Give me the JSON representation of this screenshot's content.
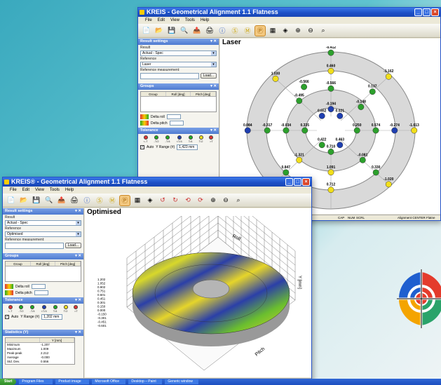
{
  "back_window": {
    "title": "KREIS - Geometrical Alignment 1.1  Flatness",
    "menu": [
      "File",
      "Edit",
      "View",
      "Tools",
      "Help"
    ],
    "panels": {
      "result_settings": {
        "header": "Result settings",
        "result_label": "Result",
        "result_value": "Actual - Spec",
        "reference_label": "Reference",
        "reference_value": "Laser",
        "ref_measurement_label": "Reference measurement:",
        "load_button": "Load..."
      },
      "groups": {
        "header": "Groups",
        "columns": [
          "Group",
          "Roll [deg]",
          "Pitch [deg]"
        ],
        "delta_roll_label": "Delta roll",
        "delta_pitch_label": "Delta pitch"
      },
      "tolerance": {
        "header": "Tolerance",
        "labels": [
          "<-T",
          "-T/2",
          "-T/4",
          "<T/4",
          "T/4",
          "T/2",
          ">T"
        ],
        "auto_label": "Auto",
        "yrange_label": "Y Range (#)",
        "yrange_value": "1,423 mm"
      }
    },
    "main_title": "Laser",
    "status": [
      "CAP",
      "NUM",
      "SCRL"
    ],
    "status_right": "Alignment CENTER Flatne",
    "values": [
      {
        "t": "-0.412",
        "c": "green"
      },
      {
        "t": "0.460",
        "c": "yellow"
      },
      {
        "t": "-1.162",
        "c": "yellow"
      },
      {
        "t": "1.030",
        "c": "yellow"
      },
      {
        "t": "-0.566",
        "c": "green"
      },
      {
        "t": "-0.566",
        "c": "green"
      },
      {
        "t": "0.137",
        "c": "green"
      },
      {
        "t": "-0.495",
        "c": "green"
      },
      {
        "t": "-0.148",
        "c": "green"
      },
      {
        "t": "-0.194",
        "c": "blue"
      },
      {
        "t": "0.652",
        "c": "blue"
      },
      {
        "t": "0.021",
        "c": "blue"
      },
      {
        "t": "0.084",
        "c": "blue"
      },
      {
        "t": "-0.317",
        "c": "green"
      },
      {
        "t": "-0.034",
        "c": "green"
      },
      {
        "t": "0.335",
        "c": "green"
      },
      {
        "t": "0.250",
        "c": "green"
      },
      {
        "t": "0.574",
        "c": "green"
      },
      {
        "t": "-0.274",
        "c": "blue"
      },
      {
        "t": "-1.613",
        "c": "yellow"
      },
      {
        "t": "0.422",
        "c": "green"
      },
      {
        "t": "0.463",
        "c": "blue"
      },
      {
        "t": "0.710",
        "c": "green"
      },
      {
        "t": "-1.321",
        "c": "yellow"
      },
      {
        "t": "-0.081",
        "c": "green"
      },
      {
        "t": "0.847",
        "c": "green"
      },
      {
        "t": "1.091",
        "c": "yellow"
      },
      {
        "t": "0.330",
        "c": "green"
      },
      {
        "t": "-0.903",
        "c": "blue"
      },
      {
        "t": "0.712",
        "c": "yellow"
      },
      {
        "t": "-1.020",
        "c": "yellow"
      }
    ]
  },
  "front_window": {
    "title": "KREIS® - Geometrical Alignment 1.1  Flatness",
    "menu": [
      "File",
      "Edit",
      "View",
      "Tools",
      "Help"
    ],
    "panels": {
      "result_settings": {
        "header": "Result settings",
        "result_label": "Result",
        "result_value": "Actual - Spec",
        "reference_label": "Reference",
        "reference_value": "Optimised",
        "ref_measurement_label": "Reference measurement:",
        "load_button": "Load..."
      },
      "groups": {
        "header": "Groups",
        "columns": [
          "Group",
          "Roll [deg]",
          "Pitch [deg]"
        ],
        "delta_roll_label": "Delta roll",
        "delta_pitch_label": "Delta pitch"
      },
      "tolerance": {
        "header": "Tolerance",
        "labels": [
          "<-T",
          "-T/2",
          "-T/4",
          "<T/4",
          "T/4",
          "T/2",
          ">T"
        ],
        "auto_label": "Auto",
        "yrange_label": "Y Range (#)",
        "yrange_value": "1,202 mm"
      },
      "statistics": {
        "header": "Statistics (Y)",
        "col": "Y [mm]",
        "rows": [
          {
            "k": "Minimum",
            "v": "-1.207"
          },
          {
            "k": "Maximum",
            "v": "1.009"
          },
          {
            "k": "Peak-peak",
            "v": "2.212"
          },
          {
            "k": "Average",
            "v": "-0.000"
          },
          {
            "k": "Std. Dev.",
            "v": "0.556"
          }
        ]
      }
    },
    "main_title": "Optimised",
    "axis_roll": "Roll",
    "axis_pitch": "Pitch",
    "axis_y": "Y [mm]",
    "ticks": [
      "1.202",
      "1.052",
      "0.902",
      "0.751",
      "0.601",
      "0.451",
      "0.301",
      "0.150",
      "0.000",
      "-0.150",
      "-0.301",
      "-0.451",
      "-0.601"
    ],
    "status": [
      "CAP",
      "NUM",
      "SCRL"
    ],
    "status_right": "Alignment CENTER Flatne"
  },
  "taskbar": {
    "start": "Start",
    "items": [
      "Program Files",
      "Product image",
      "Microsoft Office",
      "Desktop – Paint",
      "Generic window"
    ],
    "clock": ""
  },
  "colors": {
    "green": "#2ca02c",
    "yellow": "#f2df1b",
    "blue": "#1f3fb0",
    "accent": "#1c4ec5"
  }
}
